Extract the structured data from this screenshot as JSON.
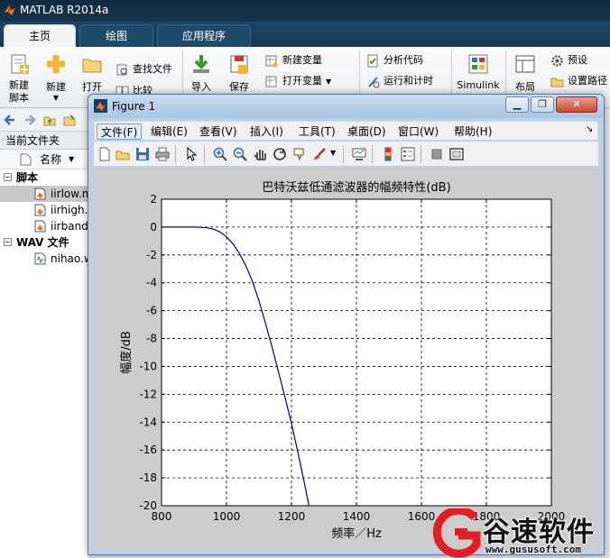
{
  "app": {
    "title": "MATLAB R2014a"
  },
  "ribbon": {
    "tabs": [
      "主页",
      "绘图",
      "应用程序"
    ],
    "new_script": "新建\n脚本",
    "new": "新建",
    "open": "打开",
    "find_files": "查找文件",
    "compare": "比较",
    "import": "导入",
    "save": "保存",
    "new_variable": "新建变量",
    "open_variable": "打开变量",
    "analyze_code": "分析代码",
    "run_and_time": "运行和计时",
    "simulink": "Simulink",
    "layout": "布局",
    "preferences": "预设",
    "set_path": "设置路径"
  },
  "left_panel": {
    "title": "当前文件夹",
    "column_name": "名称",
    "groups": [
      {
        "label": "脚本",
        "files": [
          "iirlow.m",
          "iirhigh.m",
          "iirband.m"
        ]
      },
      {
        "label": "WAV 文件",
        "files": [
          "nihao.wav"
        ]
      }
    ]
  },
  "figure": {
    "title": "Figure 1",
    "menu": [
      "文件(F)",
      "编辑(E)",
      "查看(V)",
      "插入(I)",
      "工具(T)",
      "桌面(D)",
      "窗口(W)",
      "帮助(H)"
    ],
    "toolbar_icons": [
      "new-figure-icon",
      "open-file-icon",
      "save-icon",
      "print-icon",
      "pointer-icon",
      "zoom-in-icon",
      "zoom-out-icon",
      "pan-icon",
      "rotate-3d-icon",
      "data-cursor-icon",
      "brush-icon",
      "link-plot-icon",
      "colorbar-icon",
      "legend-icon",
      "hide-plot-tools-icon",
      "show-plot-tools-icon"
    ]
  },
  "chart_data": {
    "type": "line",
    "title": "巴特沃兹低通滤波器的幅频特性(dB)",
    "xlabel": "频率／Hz",
    "ylabel": "幅度/dB",
    "xlim": [
      800,
      2000
    ],
    "ylim": [
      -20,
      2
    ],
    "x_ticks": [
      800,
      1000,
      1200,
      1400,
      1600,
      1800,
      2000
    ],
    "y_ticks": [
      2,
      0,
      -2,
      -4,
      -6,
      -8,
      -10,
      -12,
      -14,
      -16,
      -18,
      -20
    ],
    "grid": true,
    "line_color": "#00008b",
    "series": [
      {
        "x": [
          800,
          900,
          920,
          940,
          960,
          980,
          1000,
          1020,
          1040,
          1060,
          1080,
          1100,
          1120,
          1140,
          1160,
          1180,
          1200,
          1220,
          1240,
          1254
        ],
        "values": [
          0,
          0,
          -0.02,
          -0.05,
          -0.15,
          -0.35,
          -0.7,
          -1.2,
          -1.9,
          -2.8,
          -3.9,
          -5.3,
          -6.9,
          -8.6,
          -10.4,
          -12.2,
          -14.1,
          -16.2,
          -18.4,
          -20
        ]
      }
    ]
  },
  "watermark": {
    "name": "谷速软件",
    "url": "www.gususoft.com"
  }
}
